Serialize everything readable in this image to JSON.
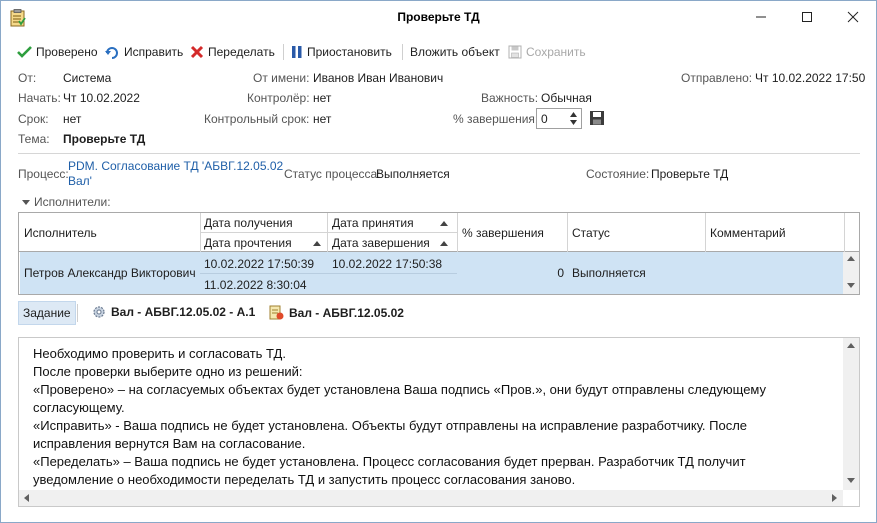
{
  "window": {
    "title": "Проверьте ТД"
  },
  "toolbar": {
    "checked": "Проверено",
    "fix": "Исправить",
    "redo": "Переделать",
    "pause": "Приостановить",
    "attach": "Вложить объект",
    "save": "Сохранить"
  },
  "details": {
    "from_label": "От:",
    "from_value": "Система",
    "behalf_label": "От имени:",
    "behalf_value": "Иванов Иван Иванович",
    "sent_label": "Отправлено:",
    "sent_value": "Чт 10.02.2022 17:50",
    "start_label": "Начать:",
    "start_value": "Чт 10.02.2022",
    "controller_label": "Контролёр:",
    "controller_value": "нет",
    "importance_label": "Важность:",
    "importance_value": "Обычная",
    "due_label": "Срок:",
    "due_value": "нет",
    "control_due_label": "Контрольный срок:",
    "control_due_value": "нет",
    "percent_label": "% завершения:",
    "percent_value": "0",
    "subject_label": "Тема:",
    "subject_value": "Проверьте ТД"
  },
  "process": {
    "label": "Процесс:",
    "link": "PDM. Согласование ТД 'АБВГ.12.05.02 Вал'",
    "status_label": "Статус процесса:",
    "status_value": "Выполняется",
    "state_label": "Состояние:",
    "state_value": "Проверьте ТД"
  },
  "executors": {
    "section_label": "Исполнители:",
    "headers": {
      "executor": "Исполнитель",
      "received": "Дата получения",
      "read": "Дата прочтения",
      "accepted": "Дата принятия",
      "completed": "Дата завершения",
      "percent": "% завершения",
      "status": "Статус",
      "comment": "Комментарий"
    },
    "rows": [
      {
        "executor": "Петров Александр Викторович",
        "received": "10.02.2022 17:50:39",
        "read": "11.02.2022 8:30:04",
        "accepted": "10.02.2022 17:50:38",
        "completed": "",
        "percent": "0",
        "status": "Выполняется",
        "comment": ""
      }
    ]
  },
  "tabs": {
    "task": "Задание",
    "item1": "Вал - АБВГ.12.05.02 - А.1",
    "item2": "Вал - АБВГ.12.05.02"
  },
  "task_text": [
    "Необходимо проверить и согласовать ТД.",
    "После проверки выберите одно из решений:",
    "«Проверено» – на согласуемых объектах будет установлена Ваша подпись «Пров.», они будут отправлены следующему",
    "согласующему.",
    "«Исправить» - Ваша подпись не будет установлена. Объекты будут отправлены на исправление разработчику. После",
    "исправления вернутся Вам на согласование.",
    "«Переделать» – Ваша подпись не будет установлена. Процесс согласования будет прерван. Разработчик ТД получит",
    "уведомление о необходимости переделать ТД и запустить процесс согласования заново."
  ],
  "colors": {
    "accent": "#1f5fa8",
    "selection": "#cfe3f4",
    "check": "#2e9e3e",
    "cross": "#d42a2a"
  },
  "icons": [
    "clipboard-icon",
    "check-icon",
    "fix-icon",
    "cross-icon",
    "pause-icon",
    "save-icon",
    "gear-icon",
    "document-icon",
    "minimize-icon",
    "maximize-icon",
    "close-icon"
  ]
}
